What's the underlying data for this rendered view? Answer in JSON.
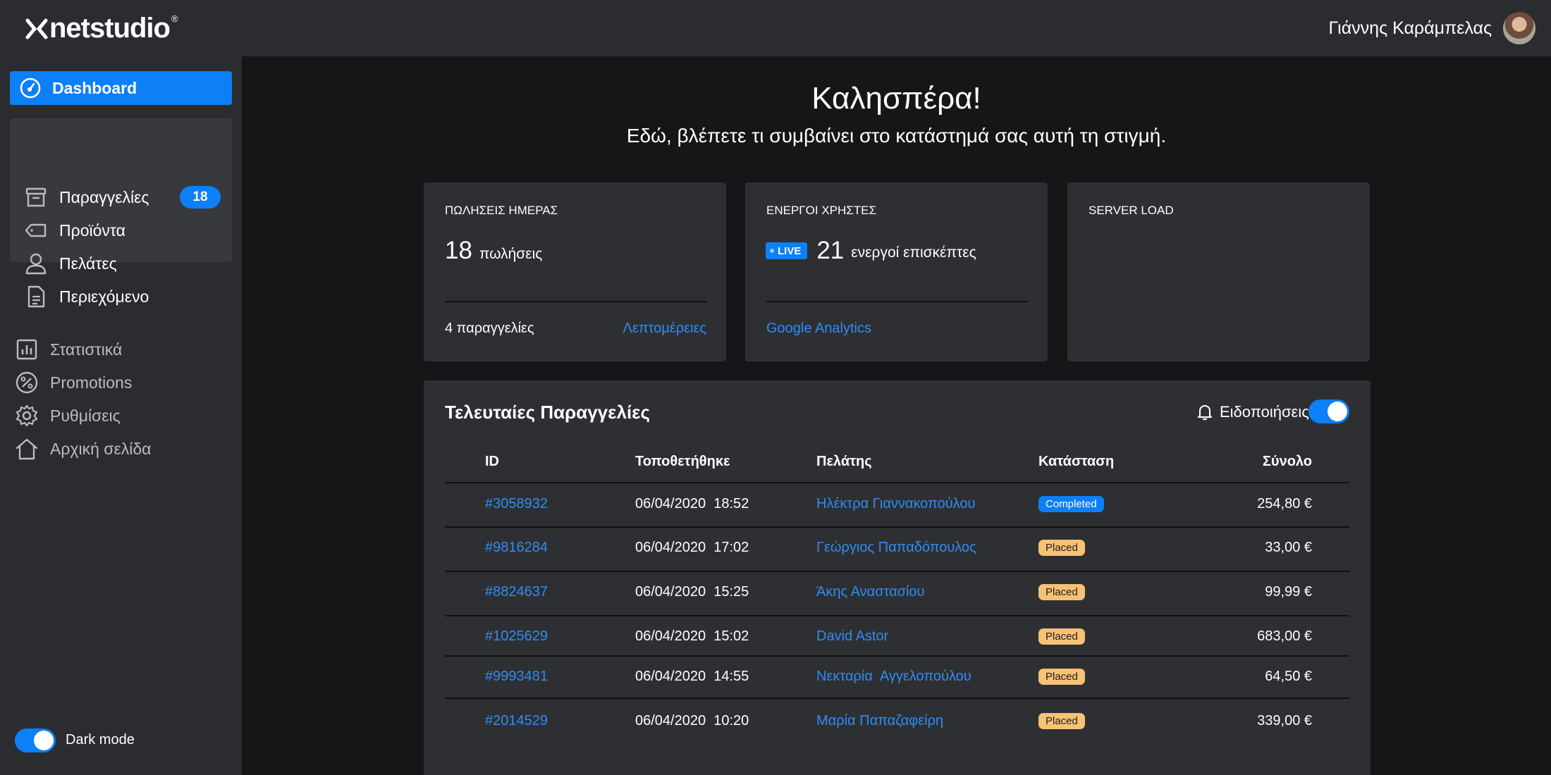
{
  "brand": {
    "name": "netstudio",
    "reg": "®"
  },
  "user": {
    "name": "Γιάννης Καράμπελας"
  },
  "sidebar": {
    "dashboard": "Dashboard",
    "items": [
      {
        "label": "Παραγγελίες",
        "icon": "archive-icon",
        "badge": "18"
      },
      {
        "label": "Προϊόντα",
        "icon": "tag-icon"
      },
      {
        "label": "Πελάτες",
        "icon": "user-icon"
      },
      {
        "label": "Περιεχόμενο",
        "icon": "document-icon"
      },
      {
        "label": "Στατιστικά",
        "icon": "chart-icon"
      },
      {
        "label": "Promotions",
        "icon": "percent-icon"
      },
      {
        "label": "Ρυθμίσεις",
        "icon": "gear-icon"
      },
      {
        "label": "Αρχική σελίδα",
        "icon": "home-icon"
      }
    ],
    "dark_mode": {
      "label": "Dark mode",
      "enabled": true
    }
  },
  "main": {
    "greeting": "Καλησπέρα!",
    "subtitle": "Εδώ, βλέπετε τι συμβαίνει στο κατάστημά σας αυτή τη στιγμή.",
    "cards": {
      "sales": {
        "title": "ΠΩΛΗΣΕΙΣ ΗΜΕΡΑΣ",
        "value": "18",
        "unit": "πωλήσεις",
        "footer": "4 παραγγελίες",
        "link": "Λεπτομέρειες"
      },
      "users": {
        "title": "ΕΝΕΡΓΟΙ ΧΡΗΣΤΕΣ",
        "live": "LIVE",
        "value": "21",
        "unit": "ενεργοί επισκέπτες",
        "link": "Google Analytics"
      },
      "server": {
        "title": "SERVER LOAD"
      }
    },
    "orders": {
      "title": "Τελευταίες Παραγγελίες",
      "notifications": {
        "label": "Ειδοποιήσεις",
        "enabled": true
      },
      "columns": [
        "ID",
        "Τοποθετήθηκε",
        "Πελάτης",
        "Κατάσταση",
        "Σύνολο"
      ],
      "rows": [
        {
          "id": "#3058932",
          "date": "06/04/2020  18:52",
          "customer": "Ηλέκτρα Γιαννακοπούλου",
          "status": "Completed",
          "total": "254,80 €"
        },
        {
          "id": "#9816284",
          "date": "06/04/2020  17:02",
          "customer": "Γεώργιος Παπαδόπουλος",
          "status": "Placed",
          "total": "33,00 €"
        },
        {
          "id": "#8824637",
          "date": "06/04/2020  15:25",
          "customer": "Άκης Αναστασίου",
          "status": "Placed",
          "total": "99,99 €"
        },
        {
          "id": "#1025629",
          "date": "06/04/2020  15:02",
          "customer": "David Astor",
          "status": "Placed",
          "total": "683,00 €"
        },
        {
          "id": "#9993481",
          "date": "06/04/2020  14:55",
          "customer": "Νεκταρία  Αγγελοπούλου",
          "status": "Placed",
          "total": "64,50 €"
        },
        {
          "id": "#2014529",
          "date": "06/04/2020  10:20",
          "customer": "Μαρία Παπαζαφείρη",
          "status": "Placed",
          "total": "339,00 €"
        }
      ]
    }
  }
}
